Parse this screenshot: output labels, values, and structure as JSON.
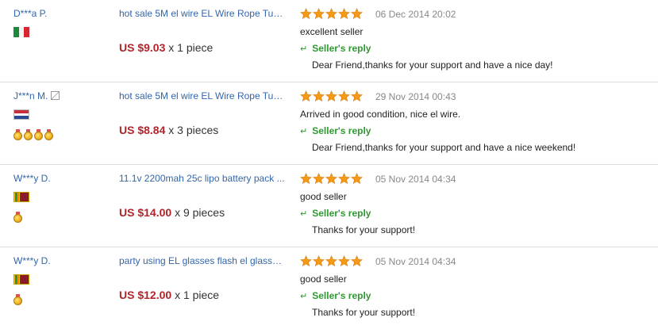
{
  "colors": {
    "link": "#3366aa",
    "price": "#b0242a",
    "reply_green": "#2f9a2f",
    "date_gray": "#888888",
    "star_orange": "#f39a1d",
    "divider": "#dddddd"
  },
  "icons": {
    "star": "star-icon",
    "reply_arrow": "reply-arrow-icon",
    "medal": "medal-icon",
    "edit": "edit-icon"
  },
  "feedback": [
    {
      "buyer": "D***a P.",
      "country_flag": "mexico",
      "medal_count": 0,
      "has_edit_icon": false,
      "product": "hot sale 5M el wire EL Wire Rope Tube ...",
      "price": "US $9.03",
      "quantity": "x 1 piece",
      "rating": 5,
      "date": "06 Dec 2014 20:02",
      "comment": "excellent seller",
      "reply_label": "Seller's reply",
      "reply_arrow": "↵",
      "reply_text": "Dear Friend,thanks for your support and have a nice day!"
    },
    {
      "buyer": "J***n M.",
      "country_flag": "netherlands",
      "medal_count": 4,
      "has_edit_icon": true,
      "product": "hot sale 5M el wire EL Wire Rope Tube ...",
      "price": "US $8.84",
      "quantity": "x 3 pieces",
      "rating": 5,
      "date": "29 Nov 2014 00:43",
      "comment": "Arrived in good condition, nice el wire.",
      "reply_label": "Seller's reply",
      "reply_arrow": "↵",
      "reply_text": "Dear Friend,thanks for your support and have a nice weekend!"
    },
    {
      "buyer": "W***y D.",
      "country_flag": "sri-lanka",
      "medal_count": 1,
      "has_edit_icon": false,
      "product": "11.1v 2200mah 25c lipo battery pack ...",
      "price": "US $14.00",
      "quantity": "x 9 pieces",
      "rating": 5,
      "date": "05 Nov 2014 04:34",
      "comment": "good seller",
      "reply_label": "Seller's reply",
      "reply_arrow": "↵",
      "reply_text": "Thanks for your support!"
    },
    {
      "buyer": "W***y D.",
      "country_flag": "sri-lanka",
      "medal_count": 1,
      "has_edit_icon": false,
      "product": "party using EL glasses flash el glasses ...",
      "price": "US $12.00",
      "quantity": "x 1 piece",
      "rating": 5,
      "date": "05 Nov 2014 04:34",
      "comment": "good seller",
      "reply_label": "Seller's reply",
      "reply_arrow": "↵",
      "reply_text": "Thanks for your support!"
    }
  ]
}
